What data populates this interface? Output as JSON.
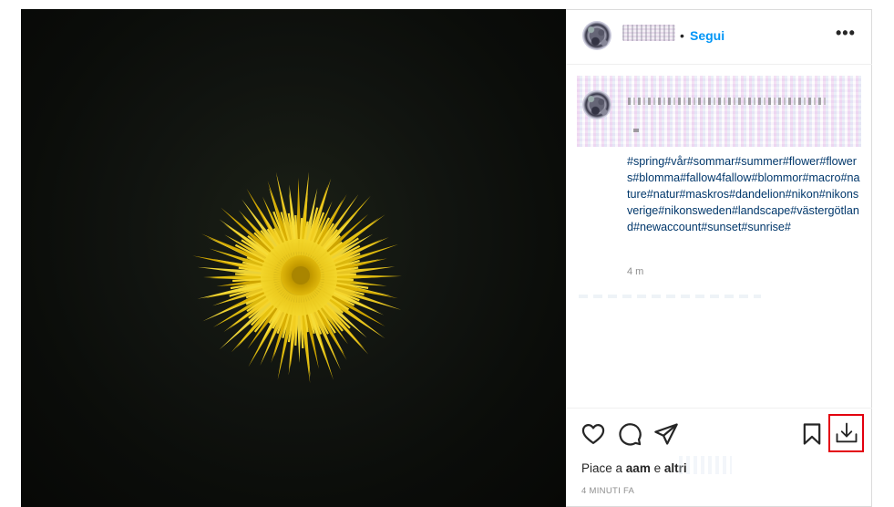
{
  "post": {
    "follow_label": "Segui",
    "separator": "•",
    "more_label": "•••",
    "hashtags": "#spring#vår#sommar#summer#flower#flowers#blomma#fallow4fallow#blommor#macro#nature#natur#maskros#dandelion#nikon#nikonsverige#nikonsweden#landscape#västergötland#newaccount#sunset#sunrise#",
    "caption_time": "4 m",
    "likes_prefix": "Piace a",
    "likes_user": "aam",
    "likes_and": "e",
    "likes_others": "altri",
    "post_time": "4 MINUTI FA"
  },
  "icons": {
    "like": "heart-icon",
    "comment": "comment-bubble-icon",
    "share": "paper-plane-icon",
    "save": "bookmark-icon",
    "download": "download-icon"
  },
  "colors": {
    "follow": "#0095f6",
    "hashtag": "#00376b",
    "highlight_box": "#e3000f",
    "flower": "#e9c200"
  }
}
